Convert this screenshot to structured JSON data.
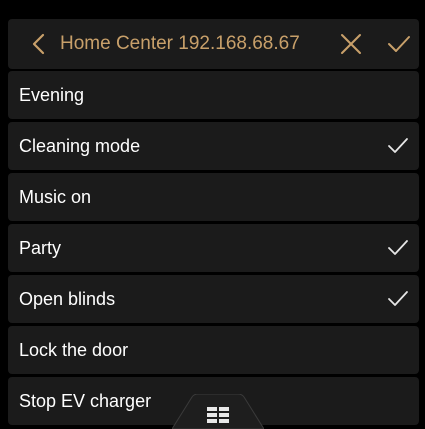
{
  "colors": {
    "accent": "#c8a06a",
    "background": "#000000",
    "row": "#1b1b1b",
    "text": "#ffffff",
    "check": "#e6e6e6"
  },
  "header": {
    "title": "Home Center 192.168.68.67",
    "back_icon": "chevron-left-icon",
    "close_icon": "close-icon",
    "confirm_icon": "checkmark-icon"
  },
  "scenes": [
    {
      "label": "Evening",
      "checked": false
    },
    {
      "label": "Cleaning mode",
      "checked": true
    },
    {
      "label": "Music on",
      "checked": false
    },
    {
      "label": "Party",
      "checked": true
    },
    {
      "label": "Open blinds",
      "checked": true
    },
    {
      "label": "Lock the door",
      "checked": false
    },
    {
      "label": "Stop EV charger",
      "checked": false
    }
  ],
  "bottom_tab": {
    "icon": "grid-menu-icon"
  }
}
